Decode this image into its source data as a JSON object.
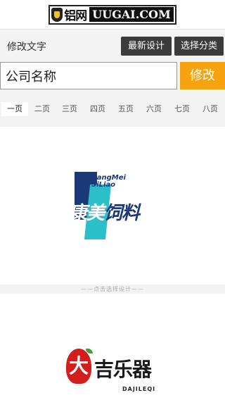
{
  "brand": {
    "name_cn": "铝网",
    "name_en": "UUGAI.COM",
    "icon": "shield-icon",
    "accent": "#f0c12b"
  },
  "toolbar": {
    "label": "修改文字",
    "latest_design": "最新设计",
    "select_category": "选择分类"
  },
  "input": {
    "company_name": "公司名称",
    "modify": "修改"
  },
  "tabs": [
    "一页",
    "二页",
    "三页",
    "四页",
    "五页",
    "六页",
    "七页",
    "八页"
  ],
  "active_tab": 0,
  "divider": "——点击选择设计——",
  "designs": [
    {
      "en_line1": "KangMei",
      "en_line2": "SiLiao",
      "cn_a": "康美",
      "cn_b": "饲料"
    },
    {
      "seal": "大",
      "cn": "吉乐器",
      "en": "DAJILEQI"
    }
  ],
  "colors": {
    "modify_button": "#f7a20f",
    "dark_button": "#3b3b3b",
    "logo_navy": "#1c3977",
    "logo_teal": "#2bbfca",
    "logo_red": "#d41e1e"
  }
}
